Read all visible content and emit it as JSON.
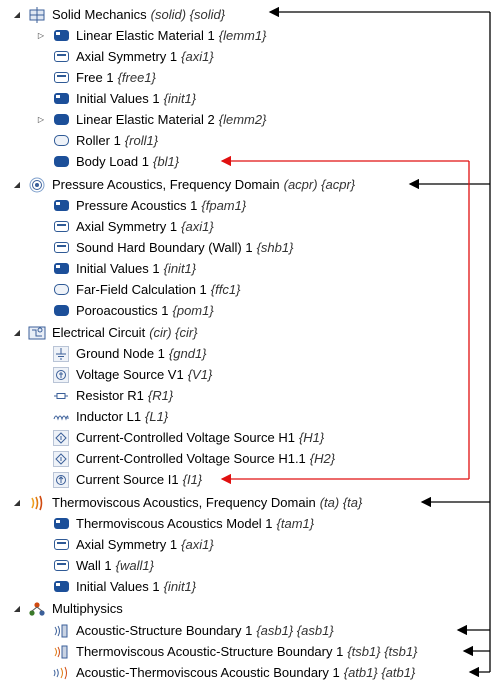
{
  "tree": {
    "solid": {
      "label": "Solid Mechanics",
      "tag": "(solid) {solid}",
      "children": [
        {
          "label": "Linear Elastic Material 1",
          "tag": "{lemm1}"
        },
        {
          "label": "Axial Symmetry 1",
          "tag": "{axi1}"
        },
        {
          "label": "Free 1",
          "tag": "{free1}"
        },
        {
          "label": "Initial Values 1",
          "tag": "{init1}"
        },
        {
          "label": "Linear Elastic Material 2",
          "tag": "{lemm2}"
        },
        {
          "label": "Roller 1",
          "tag": "{roll1}"
        },
        {
          "label": "Body Load 1",
          "tag": "{bl1}"
        }
      ]
    },
    "acpr": {
      "label": "Pressure Acoustics, Frequency Domain",
      "tag": "(acpr) {acpr}",
      "children": [
        {
          "label": "Pressure Acoustics 1",
          "tag": "{fpam1}"
        },
        {
          "label": "Axial Symmetry 1",
          "tag": "{axi1}"
        },
        {
          "label": "Sound Hard Boundary (Wall) 1",
          "tag": "{shb1}"
        },
        {
          "label": "Initial Values 1",
          "tag": "{init1}"
        },
        {
          "label": "Far-Field Calculation 1",
          "tag": "{ffc1}"
        },
        {
          "label": "Poroacoustics 1",
          "tag": "{pom1}"
        }
      ]
    },
    "cir": {
      "label": "Electrical Circuit",
      "tag": "(cir) {cir}",
      "children": [
        {
          "label": "Ground Node 1",
          "tag": "{gnd1}"
        },
        {
          "label": "Voltage Source V1",
          "tag": "{V1}"
        },
        {
          "label": "Resistor R1",
          "tag": "{R1}"
        },
        {
          "label": "Inductor L1",
          "tag": "{L1}"
        },
        {
          "label": "Current-Controlled Voltage Source H1",
          "tag": "{H1}"
        },
        {
          "label": "Current-Controlled Voltage Source H1.1",
          "tag": "{H2}"
        },
        {
          "label": "Current Source I1",
          "tag": "{I1}"
        }
      ]
    },
    "ta": {
      "label": "Thermoviscous Acoustics, Frequency Domain",
      "tag": "(ta) {ta}",
      "children": [
        {
          "label": "Thermoviscous Acoustics Model 1",
          "tag": "{tam1}"
        },
        {
          "label": "Axial Symmetry 1",
          "tag": "{axi1}"
        },
        {
          "label": "Wall 1",
          "tag": "{wall1}"
        },
        {
          "label": "Initial Values 1",
          "tag": "{init1}"
        }
      ]
    },
    "multi": {
      "label": "Multiphysics",
      "children": [
        {
          "label": "Acoustic-Structure Boundary 1",
          "tag": "{asb1} {asb1}"
        },
        {
          "label": "Thermoviscous Acoustic-Structure Boundary 1",
          "tag": "{tsb1} {tsb1}"
        },
        {
          "label": "Acoustic-Thermoviscous Acoustic Boundary 1",
          "tag": "{atb1} {atb1}"
        }
      ]
    }
  },
  "colors": {
    "link_arrow": "#000000",
    "coupling_arrow": "#e01010",
    "node_blue": "#1c4f99"
  }
}
